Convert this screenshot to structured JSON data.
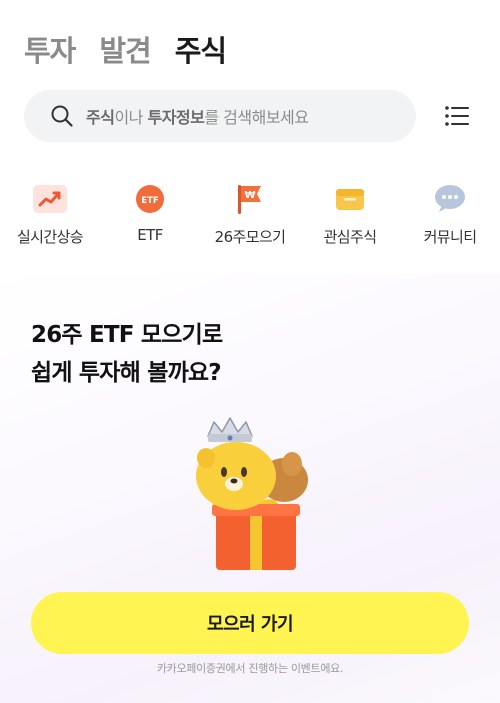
{
  "tabs": [
    {
      "label": "투자"
    },
    {
      "label": "발견"
    },
    {
      "label": "주식",
      "active": true
    }
  ],
  "search": {
    "part1_bold": "주식",
    "part2": "이나 ",
    "part3_bold": "투자정보",
    "part4": "를 검색해보세요"
  },
  "quick_menu": [
    {
      "label": "실시간상승",
      "icon": "trending-up-icon"
    },
    {
      "label": "ETF",
      "icon": "etf-icon"
    },
    {
      "label": "26주모으기",
      "icon": "flag-icon"
    },
    {
      "label": "관심주식",
      "icon": "wallet-icon"
    },
    {
      "label": "커뮤니티",
      "icon": "chat-bubble-icon"
    }
  ],
  "promo": {
    "title_line1": "26주 ETF 모으기로",
    "title_line2": "쉽게 투자해 볼까요?",
    "cta_label": "모으러 가기",
    "footnote": "카카오페이증권에서 진행하는 이벤트에요."
  },
  "icon_text": {
    "etf": "ETF",
    "won": "₩"
  },
  "colors": {
    "accent_yellow": "#fff451",
    "etf_orange": "#f26b3a",
    "trend_red": "#f0563a",
    "flag_orange": "#f2703c",
    "wallet_yellow": "#f8c64a",
    "chat_blue": "#b7c6dc"
  }
}
